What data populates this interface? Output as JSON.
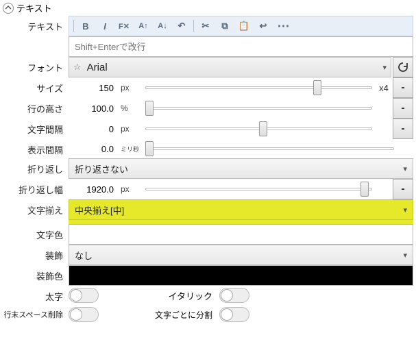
{
  "section": {
    "title": "テキスト"
  },
  "labels": {
    "text": "テキスト",
    "font": "フォント",
    "size": "サイズ",
    "lineHeight": "行の高さ",
    "letterSpacing": "文字間隔",
    "displaySpacing": "表示間隔",
    "wrap": "折り返し",
    "wrapWidth": "折り返し幅",
    "align": "文字揃え",
    "textColor": "文字色",
    "decoration": "装飾",
    "decorationColor": "装飾色",
    "bold": "太字",
    "italic": "イタリック",
    "trimTrailing": "行末スペース削除",
    "splitPerChar": "文字ごとに分割"
  },
  "text": {
    "placeholder": "Shift+Enterで改行"
  },
  "font": {
    "value": "Arial"
  },
  "size": {
    "value": "150",
    "unit": "px",
    "suffix": "x4",
    "thumb": 0.74
  },
  "lineHeight": {
    "value": "100.0",
    "unit": "%",
    "thumb": 0.0
  },
  "letterSpacing": {
    "value": "0",
    "unit": "px",
    "thumb": 0.5
  },
  "displaySpacing": {
    "value": "0.0",
    "unit": "ミリ秒",
    "thumb": 0.0
  },
  "wrap": {
    "value": "折り返さない"
  },
  "wrapWidth": {
    "value": "1920.0",
    "unit": "px",
    "thumb": 0.95
  },
  "align": {
    "value": "中央揃え[中]"
  },
  "decoration": {
    "value": "なし"
  },
  "buttons": {
    "minus": "-"
  }
}
